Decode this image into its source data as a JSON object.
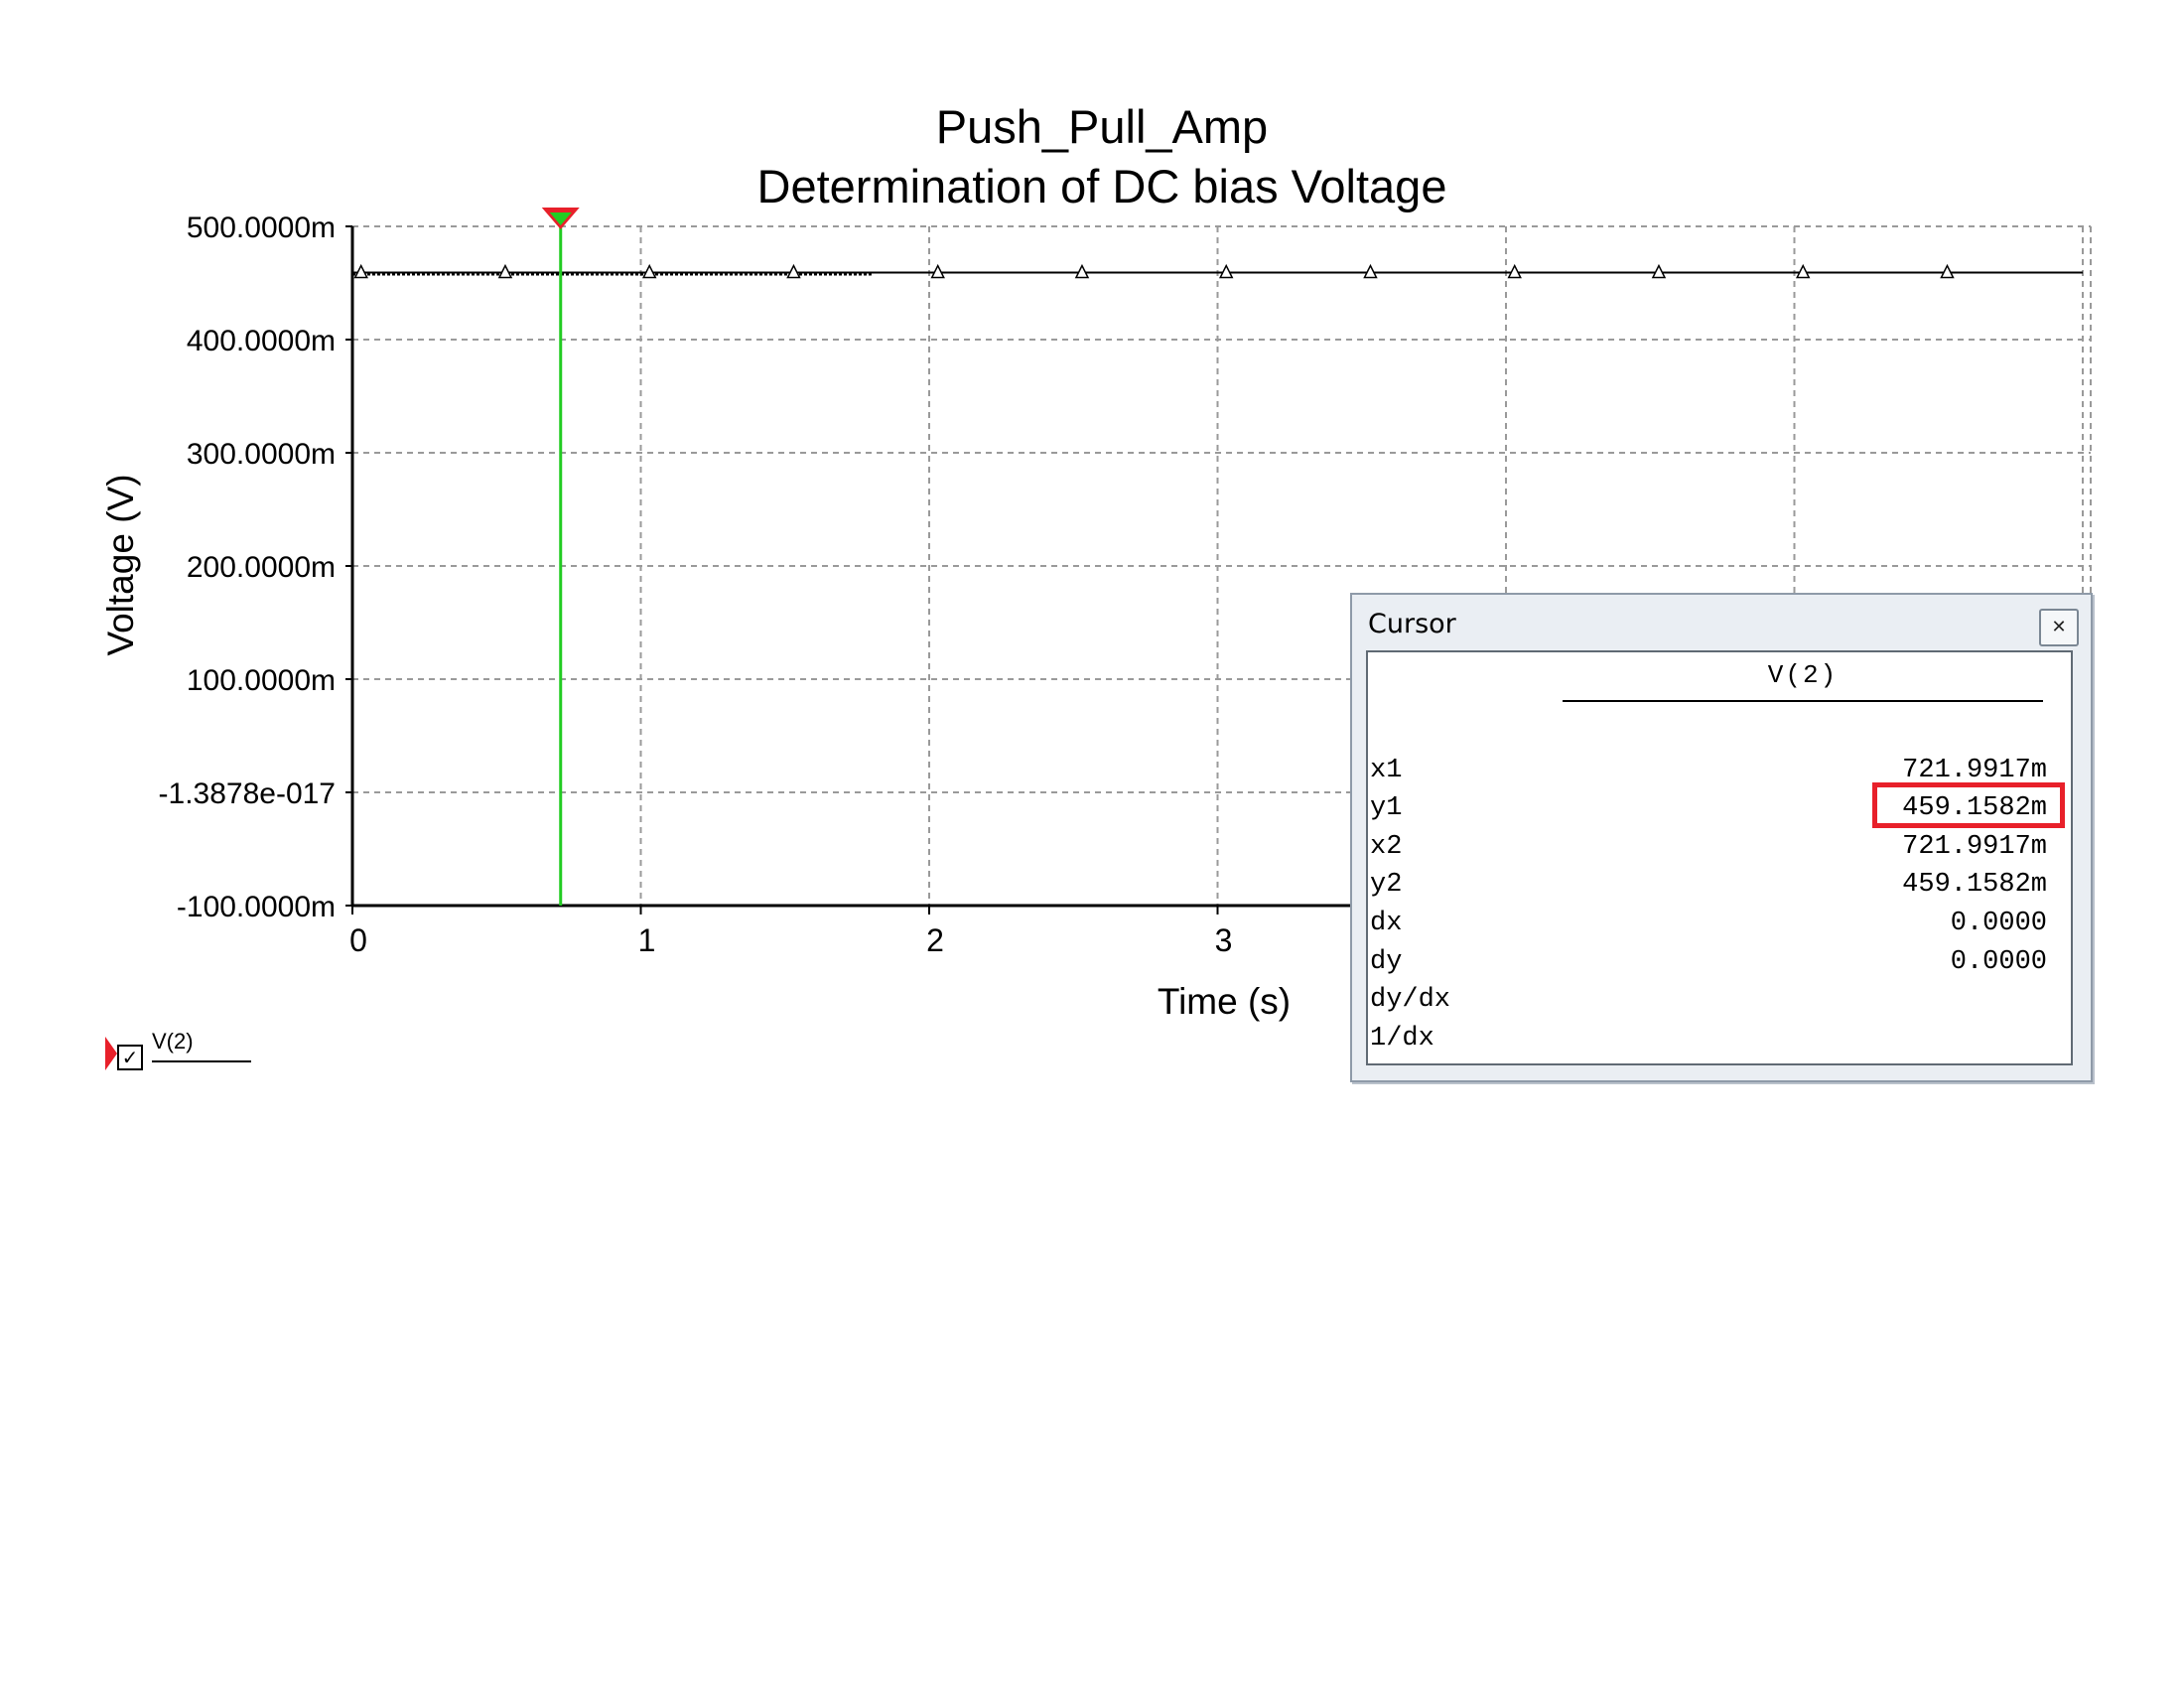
{
  "chart_data": {
    "type": "line",
    "title": "Push_Pull_Amp",
    "subtitle": "Determination of DC bias Voltage",
    "xlabel": "Time (s)",
    "ylabel": "Voltage (V)",
    "xlim": [
      0,
      6
    ],
    "ylim": [
      -0.1,
      0.5
    ],
    "x_ticks": [
      0,
      1,
      2,
      3
    ],
    "x_tick_labels": [
      "0",
      "1",
      "2",
      "3"
    ],
    "y_ticks": [
      0.5,
      0.4,
      0.3,
      0.2,
      0.1,
      0,
      -0.1
    ],
    "y_tick_labels": [
      "500.0000m",
      "400.0000m",
      "300.0000m",
      "200.0000m",
      "100.0000m",
      "-1.3878e-017",
      "-100.0000m"
    ],
    "grid": true,
    "series": [
      {
        "name": "V(2)",
        "x": [
          0,
          6
        ],
        "y": [
          0.459158,
          0.459158
        ],
        "marker": "triangle",
        "marker_x": [
          0.03,
          0.53,
          1.03,
          1.53,
          2.03,
          2.53,
          3.03,
          3.53,
          4.03,
          4.53,
          5.03,
          5.53
        ],
        "color": "#000000"
      }
    ],
    "cursor": {
      "x": 0.7219917,
      "color": "#22cc22"
    },
    "legend": "bottom-left"
  },
  "cursor_window": {
    "title": "Cursor",
    "close_icon": "close-icon",
    "column_header": "V(2)",
    "rows": [
      {
        "label": "x1",
        "value": "721.9917m"
      },
      {
        "label": "y1",
        "value": "459.1582m"
      },
      {
        "label": "x2",
        "value": "721.9917m"
      },
      {
        "label": "y2",
        "value": "459.1582m"
      },
      {
        "label": "dx",
        "value": "0.0000"
      },
      {
        "label": "dy",
        "value": "0.0000"
      },
      {
        "label": "dy/dx",
        "value": ""
      },
      {
        "label": "1/dx",
        "value": ""
      }
    ],
    "highlight_color": "#e8202a"
  },
  "legend": {
    "label": "V(2)",
    "checked": true,
    "check_glyph": "✓",
    "marker_color": "#e8202a"
  }
}
